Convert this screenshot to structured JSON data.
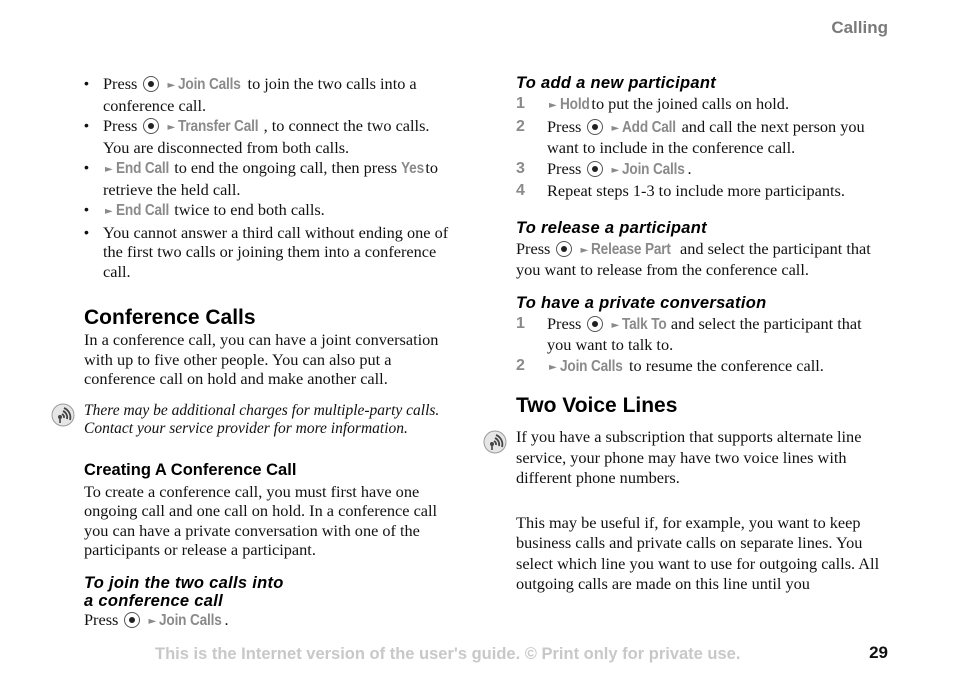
{
  "header": {
    "section": "Calling"
  },
  "left": {
    "bullets": [
      {
        "pre": "Press",
        "key": true,
        "menu": "Join Calls",
        "post": " to join the two calls into a conference call."
      },
      {
        "pre": "Press",
        "key": true,
        "menu": "Transfer Call",
        "post": ", to connect the two calls. You are disconnected from both calls."
      },
      {
        "pre": "",
        "key": false,
        "menu": "End Call",
        "post": " to end the ongoing call, then press ",
        "menu2": "Yes",
        "post2": " to retrieve the held call."
      },
      {
        "pre": "",
        "key": false,
        "menu": "End Call",
        "post": " twice to end both calls."
      },
      {
        "text": "You cannot answer a third call without ending one of the first two calls or joining them into a conference call."
      }
    ],
    "conference": {
      "heading": "Conference Calls",
      "body": "In a conference call, you can have a joint conversation with up to five other people. You can also put a conference call on hold and make another call.",
      "note_icon": "network-service-icon",
      "note": "There may be additional charges for multiple-party calls. Contact your service provider for more information."
    },
    "creating": {
      "heading": "Creating A Conference Call",
      "body": "To create a conference call, you must first have one ongoing call and one call on hold. In a conference call you can have a private conversation with one of the participants or release a participant."
    },
    "join": {
      "heading_line1": "To join the two calls into",
      "heading_line2": "a conference call",
      "press": "Press",
      "menu": "Join Calls",
      "post": "."
    }
  },
  "right": {
    "add": {
      "heading": "To add a new participant",
      "steps": [
        {
          "num": "1",
          "pre": "",
          "key": false,
          "menu": "Hold",
          "post": " to put the joined calls on hold."
        },
        {
          "num": "2",
          "pre": "Press",
          "key": true,
          "menu": "Add Call",
          "post": " and call the next person you want to include in the conference call."
        },
        {
          "num": "3",
          "pre": "Press",
          "key": true,
          "menu": "Join Calls",
          "post": "."
        },
        {
          "num": "4",
          "text": "Repeat steps 1-3 to include more participants."
        }
      ]
    },
    "release": {
      "heading": "To release a participant",
      "press": "Press",
      "menu": "Release Part",
      "post": " and select the participant that you want to release from the conference call."
    },
    "private": {
      "heading": "To have a private conversation",
      "steps": [
        {
          "num": "1",
          "pre": "Press",
          "key": true,
          "menu": "Talk To",
          "post": " and select the participant that you want to talk to."
        },
        {
          "num": "2",
          "pre": "",
          "key": false,
          "menu": "Join Calls",
          "post": " to resume the conference call."
        }
      ]
    },
    "two_lines": {
      "heading": "Two Voice Lines",
      "note_icon": "network-service-icon",
      "para1": "If you have a subscription that supports alternate line service, your phone may have two voice lines with different phone numbers.",
      "para2": "This may be useful if, for example, you want to keep business calls and private calls on separate lines. You select which line you want to use for outgoing calls. All outgoing calls are made on this line until you"
    }
  },
  "footer": {
    "notice": "This is the Internet version of the user's guide. © Print only for private use.",
    "page_number": "29"
  },
  "glyphs": {
    "arrow": "►"
  }
}
